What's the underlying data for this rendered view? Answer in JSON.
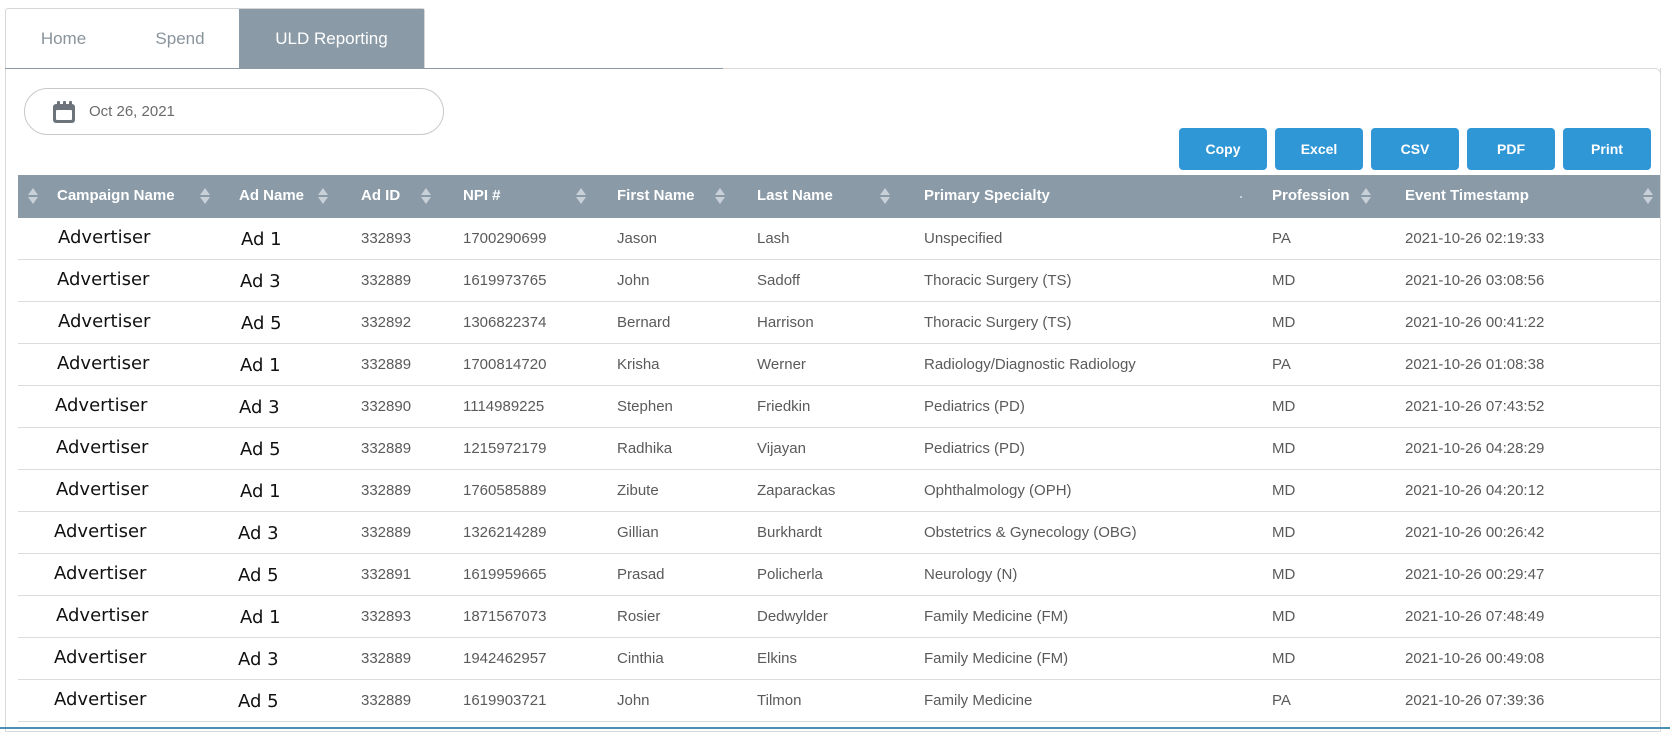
{
  "tabs": [
    {
      "label": "Home",
      "active": false
    },
    {
      "label": "Spend",
      "active": false
    },
    {
      "label": "ULD Reporting",
      "active": true
    }
  ],
  "date_picker": {
    "icon": "calendar-icon",
    "value": "Oct 26, 2021"
  },
  "export_buttons": {
    "copy": "Copy",
    "excel": "Excel",
    "csv": "CSV",
    "pdf": "PDF",
    "print": "Print"
  },
  "colors": {
    "tab_active": "#8a9aa7",
    "header_bg": "#8a9aa7",
    "button": "#3097d6"
  },
  "table": {
    "columns": [
      "Campaign Name",
      "Ad Name",
      "Ad ID",
      "NPI #",
      "First Name",
      "Last Name",
      "Primary Specialty",
      "Profession",
      "Event Timestamp"
    ],
    "rows": [
      [
        "Advertiser",
        "Ad 1",
        "332893",
        "1700290699",
        "Jason",
        "Lash",
        "Unspecified",
        "PA",
        "2021-10-26 02:19:33"
      ],
      [
        "Advertiser",
        "Ad 3",
        "332889",
        "1619973765",
        "John",
        "Sadoff",
        "Thoracic Surgery (TS)",
        "MD",
        "2021-10-26 03:08:56"
      ],
      [
        "Advertiser",
        "Ad 5",
        "332892",
        "1306822374",
        "Bernard",
        "Harrison",
        "Thoracic Surgery (TS)",
        "MD",
        "2021-10-26 00:41:22"
      ],
      [
        "Advertiser",
        "Ad 1",
        "332889",
        "1700814720",
        "Krisha",
        "Werner",
        "Radiology/Diagnostic Radiology",
        "PA",
        "2021-10-26 01:08:38"
      ],
      [
        "Advertiser",
        "Ad 3",
        "332890",
        "1114989225",
        "Stephen",
        "Friedkin",
        "Pediatrics (PD)",
        "MD",
        "2021-10-26 07:43:52"
      ],
      [
        "Advertiser",
        "Ad 5",
        "332889",
        "1215972179",
        "Radhika",
        "Vijayan",
        "Pediatrics (PD)",
        "MD",
        "2021-10-26 04:28:29"
      ],
      [
        "Advertiser",
        "Ad 1",
        "332889",
        "1760585889",
        "Zibute",
        "Zaparackas",
        "Ophthalmology (OPH)",
        "MD",
        "2021-10-26 04:20:12"
      ],
      [
        "Advertiser",
        "Ad 3",
        "332889",
        "1326214289",
        "Gillian",
        "Burkhardt",
        "Obstetrics & Gynecology (OBG)",
        "MD",
        "2021-10-26 00:26:42"
      ],
      [
        "Advertiser",
        "Ad 5",
        "332891",
        "1619959665",
        "Prasad",
        "Policherla",
        "Neurology (N)",
        "MD",
        "2021-10-26 00:29:47"
      ],
      [
        "Advertiser",
        "Ad 1",
        "332893",
        "1871567073",
        "Rosier",
        "Dedwylder",
        "Family Medicine (FM)",
        "MD",
        "2021-10-26 07:48:49"
      ],
      [
        "Advertiser",
        "Ad 3",
        "332889",
        "1942462957",
        "Cinthia",
        "Elkins",
        "Family Medicine (FM)",
        "MD",
        "2021-10-26 00:49:08"
      ],
      [
        "Advertiser",
        "Ad 5",
        "332889",
        "1619903721",
        "John",
        "Tilmon",
        "Family Medicine",
        "PA",
        "2021-10-26 07:39:36"
      ]
    ]
  }
}
